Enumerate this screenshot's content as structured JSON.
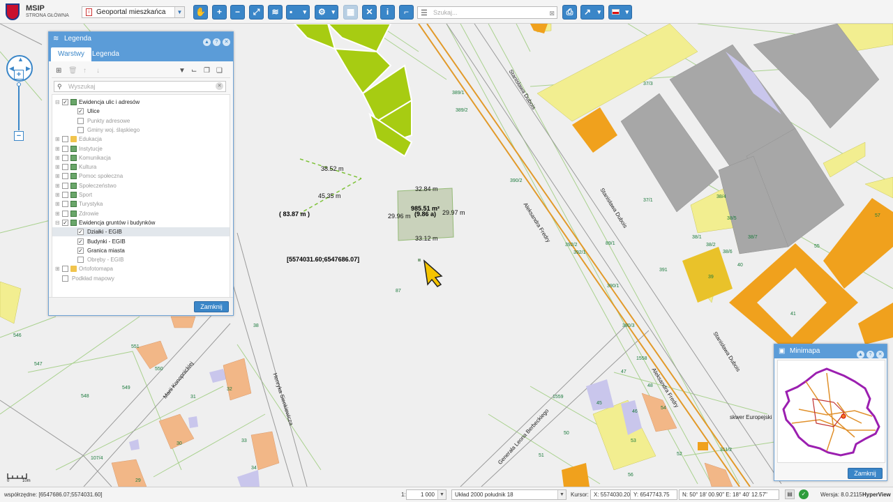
{
  "app": {
    "title": "MSIP",
    "subtitle": "STRONA GŁÓWNA",
    "portal_selected": "Geoportal mieszkańca",
    "search_placeholder": "Szukaj..."
  },
  "toolbar": {
    "icons": [
      "pan-hand-icon",
      "zoom-in-icon",
      "zoom-out-icon",
      "full-extent-icon",
      "layers-icon",
      "add-layer-icon",
      "tools-icon",
      "table-icon",
      "measure-clear-icon",
      "info-icon",
      "route-icon",
      "print-icon",
      "export-icon",
      "language-flag-icon"
    ]
  },
  "legend": {
    "title": "Legenda",
    "tabs": [
      "Warstwy",
      "Legenda"
    ],
    "active_tab": "Warstwy",
    "search_placeholder": "Wyszukaj",
    "items": [
      {
        "label": "Ewidencja ulic i adresów",
        "level": 0,
        "checked": true,
        "expanded": true,
        "gray": false,
        "type": "layer"
      },
      {
        "label": "Ulice",
        "level": 1,
        "checked": true,
        "gray": false,
        "type": "leaf"
      },
      {
        "label": "Punkty adresowe",
        "level": 1,
        "checked": false,
        "gray": true,
        "type": "leaf"
      },
      {
        "label": "Gminy woj. śląskiego",
        "level": 1,
        "checked": false,
        "gray": true,
        "type": "leaf"
      },
      {
        "label": "Edukacja",
        "level": 0,
        "checked": false,
        "gray": true,
        "type": "folder"
      },
      {
        "label": "Instytucje",
        "level": 0,
        "checked": false,
        "gray": true,
        "type": "layer"
      },
      {
        "label": "Komunikacja",
        "level": 0,
        "checked": false,
        "gray": true,
        "type": "layer"
      },
      {
        "label": "Kultura",
        "level": 0,
        "checked": false,
        "gray": true,
        "type": "layer"
      },
      {
        "label": "Pomoc społeczna",
        "level": 0,
        "checked": false,
        "gray": true,
        "type": "layer"
      },
      {
        "label": "Społeczeństwo",
        "level": 0,
        "checked": false,
        "gray": true,
        "type": "layer"
      },
      {
        "label": "Sport",
        "level": 0,
        "checked": false,
        "gray": true,
        "type": "layer"
      },
      {
        "label": "Turystyka",
        "level": 0,
        "checked": false,
        "gray": true,
        "type": "layer"
      },
      {
        "label": "Zdrowie",
        "level": 0,
        "checked": false,
        "gray": true,
        "type": "layer"
      },
      {
        "label": "Ewidencja gruntów i budynków",
        "level": 0,
        "checked": true,
        "expanded": true,
        "gray": false,
        "type": "layer"
      },
      {
        "label": "Działki - EGIB",
        "level": 1,
        "checked": true,
        "gray": false,
        "type": "leaf",
        "highlight": true
      },
      {
        "label": "Budynki - EGIB",
        "level": 1,
        "checked": true,
        "gray": false,
        "type": "leaf"
      },
      {
        "label": "Granica miasta",
        "level": 1,
        "checked": true,
        "gray": false,
        "type": "leaf"
      },
      {
        "label": "Obręby - EGIB",
        "level": 1,
        "checked": false,
        "gray": true,
        "type": "leaf"
      },
      {
        "label": "Ortofotomapa",
        "level": 0,
        "checked": false,
        "gray": true,
        "type": "folder"
      },
      {
        "label": "Podkład mapowy",
        "level": 0,
        "checked": false,
        "gray": true,
        "type": "plain"
      }
    ],
    "close_label": "Zamknij"
  },
  "minimap": {
    "title": "Minimapa",
    "close_label": "Zamknij"
  },
  "map": {
    "measurements": {
      "top": "32.84 m",
      "left": "29.96 m",
      "right": "29.97 m",
      "bottom": "33.12 m",
      "area": "985.51 m²",
      "area_ha": "(9.86 a)",
      "line1": "38.52 m",
      "line2": "45.35 m",
      "perimeter": "( 83.87 m )",
      "coordinates": "[5574031.60;6547686.07]"
    },
    "streets": [
      "Stanisława Dubois",
      "Stanisława Dubois",
      "Stanisława Dubois",
      "Aleksandra Fredry",
      "Aleksandra Fredry",
      "Marii Konopnickiej",
      "Henryka Sienkiewicza",
      "Generała Leona Berbeckiego",
      "skwer Europejski"
    ],
    "parcels": [
      "389/1",
      "389/2",
      "390/2",
      "37/3",
      "37/1",
      "38/4",
      "38/5",
      "38/1",
      "38/7",
      "38/2",
      "38/6",
      "40",
      "39",
      "55",
      "57",
      "41",
      "391",
      "390/1",
      "89/1",
      "392/2",
      "392/1",
      "390/3",
      "38",
      "87",
      "546",
      "547",
      "548",
      "549",
      "550",
      "551",
      "32",
      "31",
      "30",
      "33",
      "34",
      "29",
      "47",
      "48",
      "45",
      "46",
      "54",
      "53",
      "52",
      "56",
      "50",
      "51",
      "1558",
      "1559",
      "107/4",
      "311/2"
    ]
  },
  "status": {
    "coords_label": "współrzędne: [6547686.07;5574031.60]",
    "scale_prefix": "1:",
    "scale_value": "1 000",
    "crs": "Układ 2000 południk 18",
    "cursor_label": "Kursor:",
    "cursor_x": "X: 5574030.20",
    "cursor_y": "Y: 6547743.75",
    "latlon": "N: 50° 18' 00.90\" E: 18° 40' 12.57\"",
    "version": "Wersja: 8.0.2115",
    "vendor": "HyperView",
    "scale_zero": "0",
    "scale_len": "10m"
  }
}
